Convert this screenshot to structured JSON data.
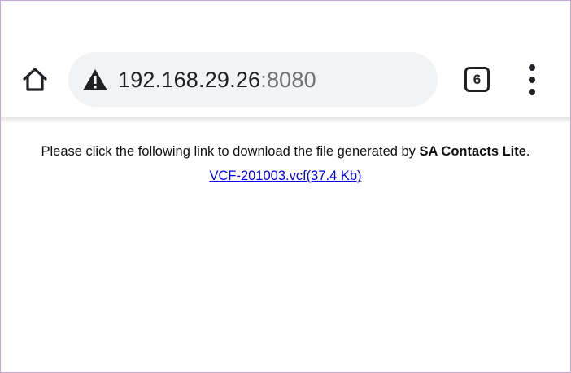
{
  "browser": {
    "url_host": "192.168.29.26",
    "url_port": ":8080",
    "tab_count": "6",
    "icons": {
      "home": "home-icon",
      "security": "warning-triangle-icon",
      "tabs": "tab-switcher-icon",
      "menu": "more-vert-icon"
    }
  },
  "page": {
    "message_prefix": "Please click the following link to download the file generated by ",
    "app_name": "SA Contacts Lite",
    "message_suffix": ".",
    "download_link": "VCF-201003.vcf(37.4 Kb)"
  },
  "colors": {
    "link": "#0000ee",
    "omnibox_bg": "#f1f3f4",
    "frame_border": "#c9a6d8"
  }
}
